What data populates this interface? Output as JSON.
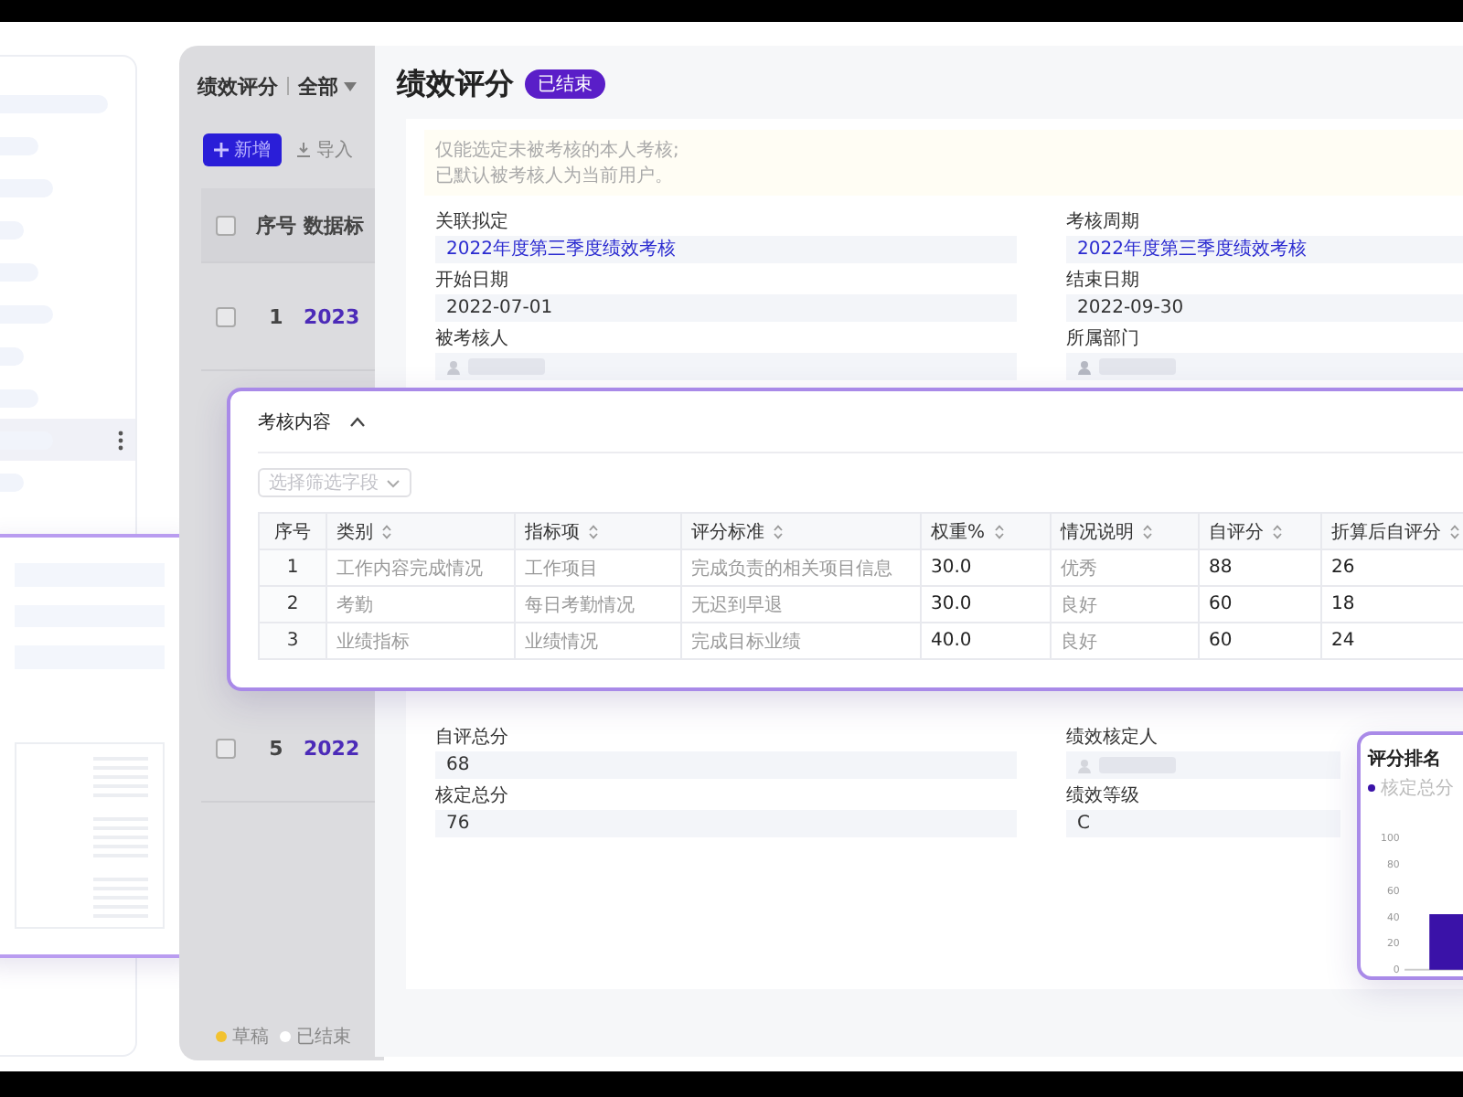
{
  "side_list": {
    "items": [
      {
        "selected": false
      },
      {
        "selected": false
      },
      {
        "selected": false
      },
      {
        "selected": false
      },
      {
        "selected": false
      },
      {
        "selected": false
      },
      {
        "selected": false
      },
      {
        "selected": false
      },
      {
        "selected": true
      },
      {
        "selected": false
      }
    ]
  },
  "list_window": {
    "title": "绩效评分",
    "filter": "全部",
    "buttons": [
      {
        "label": "新增",
        "kind": "primary"
      },
      {
        "label": "导入",
        "kind": "import"
      }
    ],
    "header_checked": false,
    "columns": [
      "序号",
      "数据标"
    ],
    "rows": [
      {
        "index": "1",
        "title": "2023",
        "checked": false
      },
      {
        "index": "5",
        "title": "2022",
        "checked": false
      }
    ],
    "legend": [
      {
        "label": "草稿",
        "color": "#f2c230"
      },
      {
        "label": "已结束",
        "color": "#ffffff"
      }
    ]
  },
  "detail": {
    "title": "绩效评分",
    "status": "已结束",
    "notice": [
      "仅能选定未被考核的本人考核;",
      "已默认被考核人为当前用户。"
    ],
    "fields": [
      {
        "label": "关联拟定",
        "value": "2022年度第三季度绩效考核",
        "kind": "link"
      },
      {
        "label": "考核周期",
        "value": "2022年度第三季度绩效考核",
        "kind": "link"
      },
      {
        "label": "开始日期",
        "value": "2022-07-01",
        "kind": "text"
      },
      {
        "label": "结束日期",
        "value": "2022-09-30",
        "kind": "text"
      },
      {
        "label": "被考核人",
        "kind": "user"
      },
      {
        "label": "所属部门",
        "kind": "dept"
      }
    ],
    "summary_fields": [
      {
        "label": "自评总分",
        "value": "68",
        "kind": "text"
      },
      {
        "label": "绩效核定人",
        "kind": "user"
      },
      {
        "label": "核定总分",
        "value": "76",
        "kind": "text"
      },
      {
        "label": "绩效等级",
        "value": "C",
        "kind": "text"
      }
    ]
  },
  "content_card": {
    "title": "考核内容",
    "expanded": true,
    "filter_placeholder": "选择筛选字段",
    "columns": [
      {
        "label": "序号",
        "sortable": false,
        "kind": "index"
      },
      {
        "label": "类别",
        "sortable": true,
        "kind": "muted"
      },
      {
        "label": "指标项",
        "sortable": true,
        "kind": "muted"
      },
      {
        "label": "评分标准",
        "sortable": true,
        "kind": "muted"
      },
      {
        "label": "权重%",
        "sortable": true,
        "kind": "strong"
      },
      {
        "label": "情况说明",
        "sortable": true,
        "kind": "muted"
      },
      {
        "label": "自评分",
        "sortable": true,
        "kind": "strong"
      },
      {
        "label": "折算后自评分",
        "sortable": true,
        "kind": "strong"
      }
    ],
    "rows": [
      [
        "1",
        "工作内容完成情况",
        "工作项目",
        "完成负责的相关项目信息",
        "30.0",
        "优秀",
        "88",
        "26"
      ],
      [
        "2",
        "考勤",
        "每日考勤情况",
        "无迟到早退",
        "30.0",
        "良好",
        "60",
        "18"
      ],
      [
        "3",
        "业绩指标",
        "业绩情况",
        "完成目标业绩",
        "40.0",
        "良好",
        "60",
        "24"
      ]
    ]
  },
  "chart_card": {
    "title": "评分排名",
    "chart_data": {
      "type": "bar",
      "series": [
        {
          "name": "核定总分",
          "color": "#3a12a8",
          "values": [
            42
          ]
        }
      ],
      "ylim": [
        0,
        100
      ],
      "yticks": [
        0,
        20,
        40,
        60,
        80,
        100
      ]
    }
  }
}
